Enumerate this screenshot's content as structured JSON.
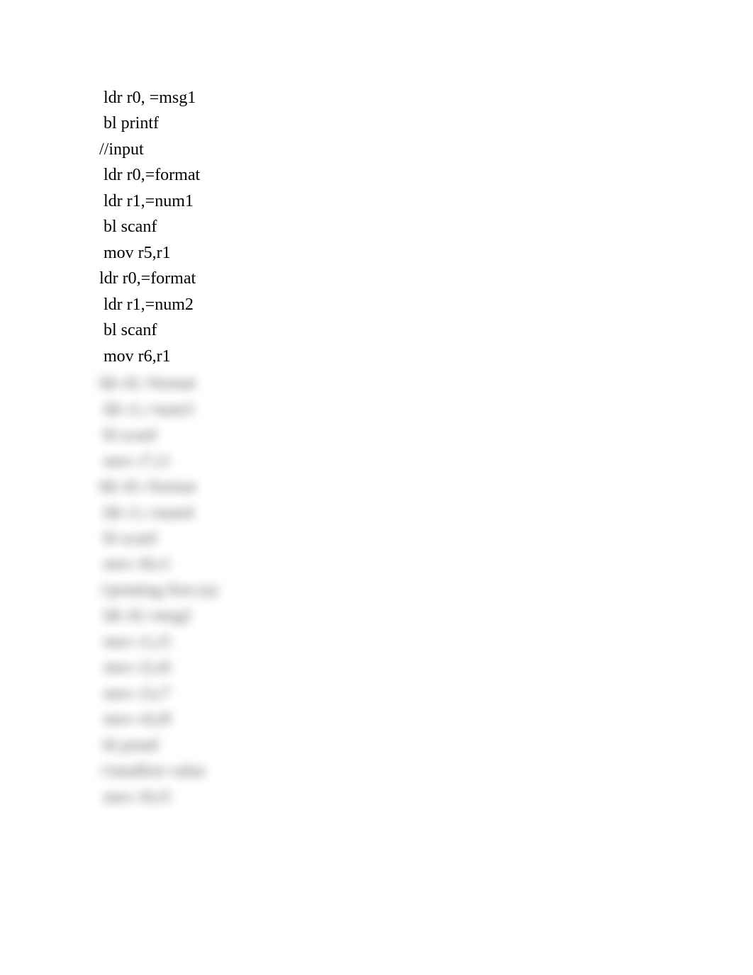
{
  "code": {
    "clear_lines": [
      " ldr r0, =msg1",
      " bl printf",
      "//input",
      " ldr r0,=format",
      " ldr r1,=num1",
      " bl scanf",
      " mov r5,r1",
      "ldr r0,=format",
      " ldr r1,=num2",
      " bl scanf",
      " mov r6,r1"
    ],
    "blurred_lines": [
      "ldr r0,=format",
      " ldr r1,=num3",
      " bl scanf",
      " mov r7,r1",
      "ldr r0,=format",
      " ldr r1,=num4",
      " bl scanf",
      " mov r8,r1",
      "//printing first (a)",
      " ldr r0,=msg2",
      " mov r1,r5",
      " mov r2,r6",
      " mov r3,r7",
      " mov r4,r8",
      " bl printf",
      "//smallest value",
      " mov r9,r5"
    ]
  }
}
